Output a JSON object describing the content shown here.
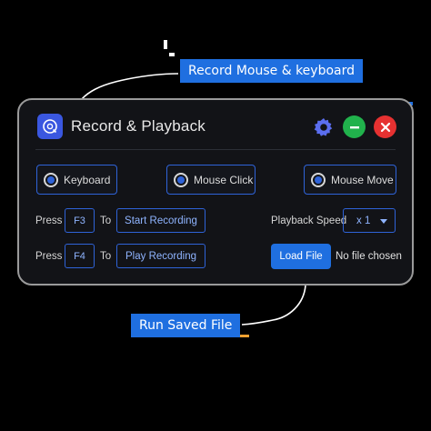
{
  "callouts": {
    "top": "Record Mouse & keyboard",
    "bottom": "Run Saved File"
  },
  "window": {
    "title": "Record & Playback",
    "icons": {
      "app": "playback-icon",
      "settings": "gear-icon",
      "minimize": "minimize-icon",
      "close": "close-icon"
    }
  },
  "options": {
    "keyboard": "Keyboard",
    "mouse_click": "Mouse Click",
    "mouse_move": "Mouse Move"
  },
  "record_row": {
    "press": "Press",
    "key": "F3",
    "to": "To",
    "action": "Start Recording"
  },
  "play_row": {
    "press": "Press",
    "key": "F4",
    "to": "To",
    "action": "Play Recording"
  },
  "playback": {
    "label": "Playback Speed",
    "speed": "x 1"
  },
  "file": {
    "load_label": "Load File",
    "status": "No file chosen"
  },
  "colors": {
    "accent": "#1f6fe0",
    "minimize": "#21b24c",
    "close": "#e63131",
    "background": "#121317"
  }
}
